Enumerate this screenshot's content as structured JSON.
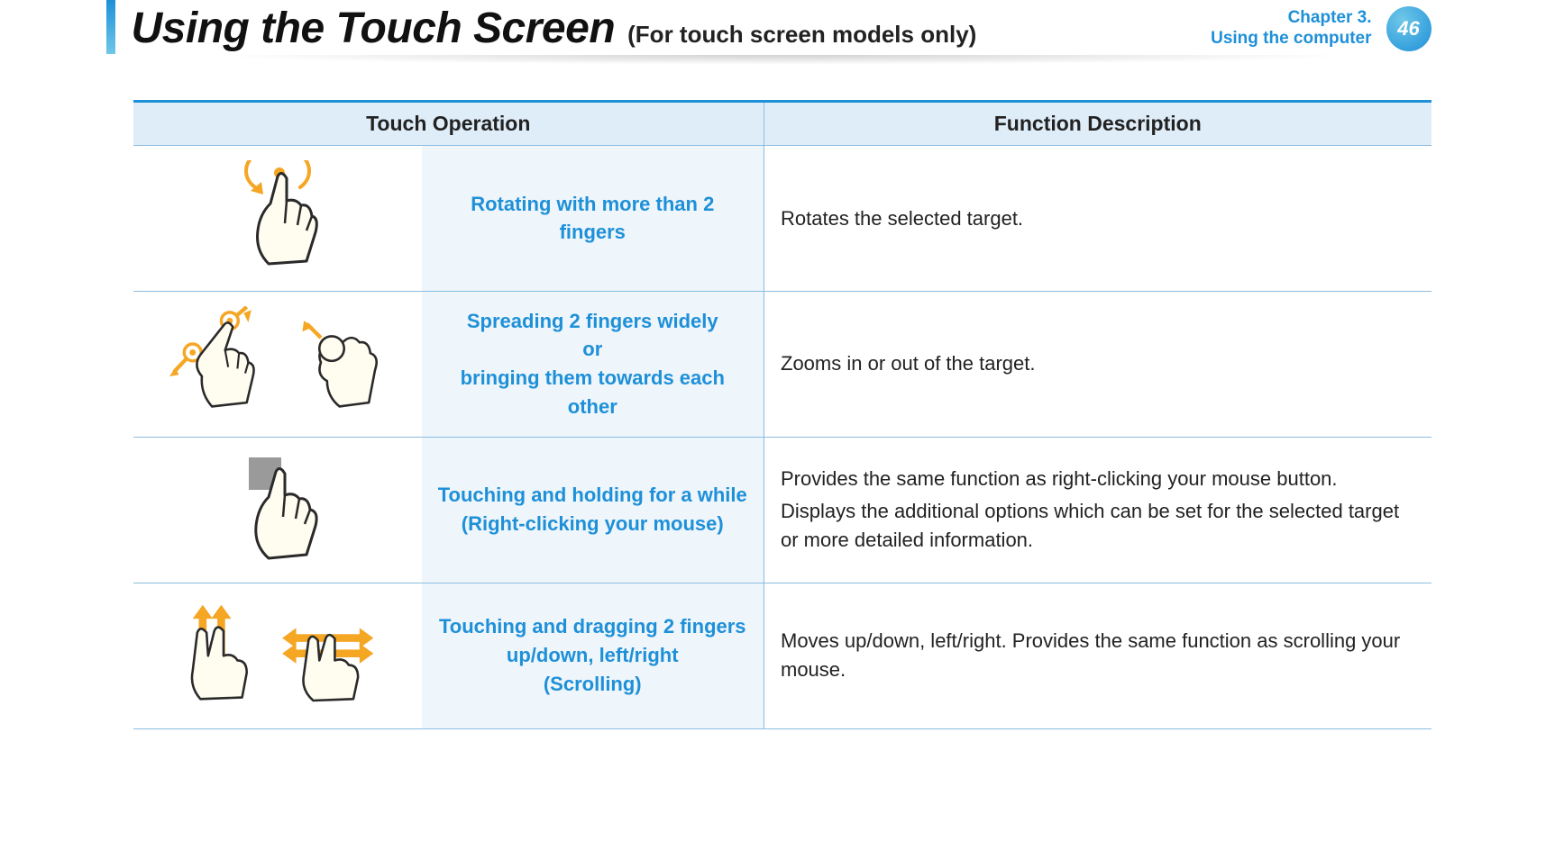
{
  "header": {
    "title": "Using the Touch Screen",
    "subtitle": "(For touch screen models only)",
    "chapter_line1": "Chapter 3.",
    "chapter_line2": "Using the computer",
    "page_number": "46"
  },
  "table": {
    "col1": "Touch Operation",
    "col2": "Function Description",
    "rows": [
      {
        "operation": "Rotating with more than 2 fingers",
        "description": [
          "Rotates the selected target."
        ]
      },
      {
        "operation": "Spreading 2 fingers widely\nor\nbringing them towards each other",
        "description": [
          "Zooms in or out of the target."
        ]
      },
      {
        "operation": "Touching and holding for a while\n(Right-clicking your mouse)",
        "description": [
          "Provides the same function as right-clicking your mouse button.",
          "Displays the additional options which can be set for the selected target or more detailed information."
        ]
      },
      {
        "operation": "Touching and dragging 2 fingers up/down, left/right\n(Scrolling)",
        "description": [
          "Moves up/down, left/right. Provides the same function as scrolling your mouse."
        ]
      }
    ]
  }
}
